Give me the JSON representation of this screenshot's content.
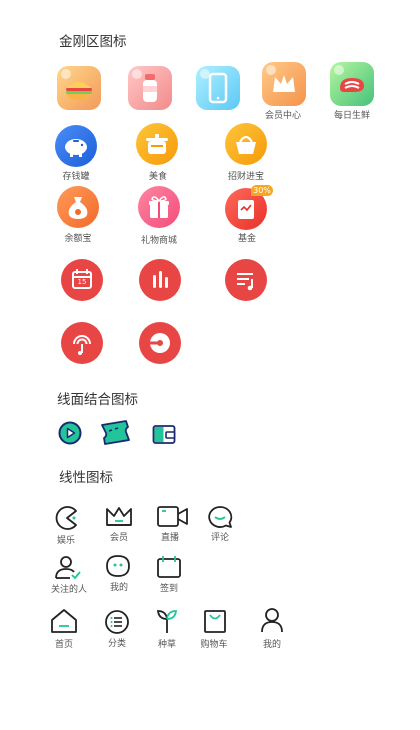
{
  "sections": {
    "kingkong": "金刚区图标",
    "line_fill": "线面结合图标",
    "linear": "线性图标"
  },
  "kingkong": {
    "row1": [
      "",
      "",
      "",
      "会员中心",
      "每日生鲜"
    ],
    "row2": [
      "存钱罐",
      "美食",
      "招财进宝"
    ],
    "row3": [
      "余额宝",
      "礼物商城",
      "基金"
    ],
    "badge": "30%",
    "calendar_number": "15"
  },
  "linear": {
    "row1": [
      "娱乐",
      "会员",
      "直播",
      "评论"
    ],
    "row2": [
      "关注的人",
      "我的",
      "签到"
    ],
    "tabbar": [
      "首页",
      "分类",
      "种草",
      "购物车",
      "我的"
    ]
  },
  "colors": {
    "red": "#e84545",
    "green_accent": "#22c49a",
    "navy": "#1a2a6e"
  }
}
